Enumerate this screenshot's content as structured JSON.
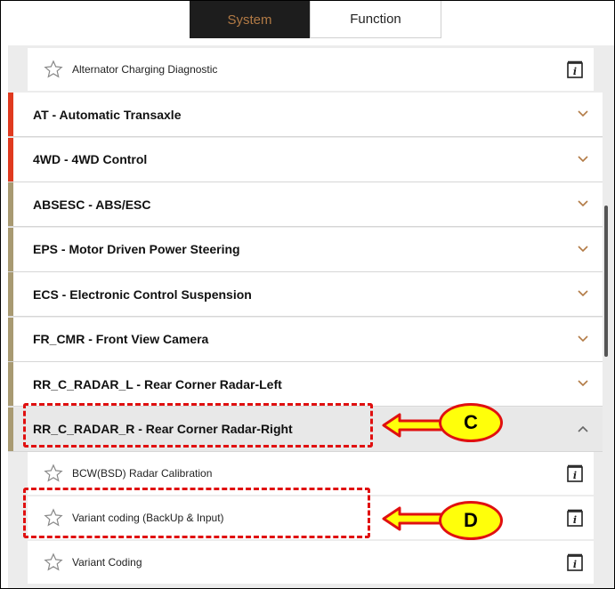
{
  "tabs": [
    {
      "label": "System"
    },
    {
      "label": "Function"
    }
  ],
  "top_sub_item": {
    "label": "Alternator Charging Diagnostic"
  },
  "systems": [
    {
      "label": "AT - Automatic Transaxle",
      "bar_color": "#e03a1f"
    },
    {
      "label": "4WD - 4WD Control",
      "bar_color": "#e03a1f"
    },
    {
      "label": "ABSESC - ABS/ESC",
      "bar_color": "#a89a72"
    },
    {
      "label": "EPS - Motor Driven Power Steering",
      "bar_color": "#a89a72"
    },
    {
      "label": "ECS - Electronic Control Suspension",
      "bar_color": "#a89a72"
    },
    {
      "label": "FR_CMR - Front View Camera",
      "bar_color": "#a89a72"
    },
    {
      "label": "RR_C_RADAR_L - Rear Corner Radar-Left",
      "bar_color": "#a89a72"
    },
    {
      "label": "RR_C_RADAR_R - Rear Corner Radar-Right",
      "bar_color": "#a89a72"
    }
  ],
  "sub_items": [
    {
      "label": "BCW(BSD) Radar Calibration"
    },
    {
      "label": "Variant coding (BackUp & Input)"
    },
    {
      "label": "Variant Coding"
    }
  ],
  "callouts": {
    "c": "C",
    "d": "D"
  },
  "colors": {
    "accent": "#b27a45",
    "highlight": "#e01010",
    "callout_fill": "#ffff0a"
  },
  "icons": {
    "star": "star-icon",
    "info": "info-icon",
    "chevron": "chevron-down-icon"
  }
}
